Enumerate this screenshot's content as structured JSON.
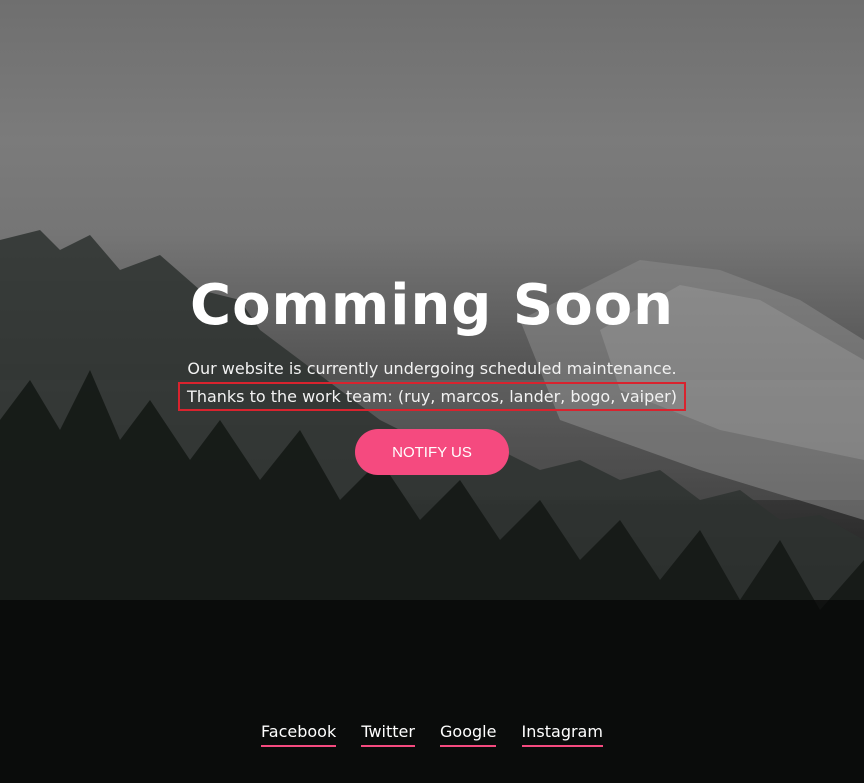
{
  "hero": {
    "title": "Comming Soon",
    "line1": "Our website is currently undergoing scheduled maintenance.",
    "line2": "Thanks to the work team: (ruy, marcos, lander, bogo, vaiper)",
    "button_label": "NOTIFY US"
  },
  "footer": {
    "links": [
      "Facebook",
      "Twitter",
      "Google",
      "Instagram"
    ]
  },
  "colors": {
    "accent": "#f54a7f",
    "highlight_border": "#d9232e",
    "text": "#ffffff"
  }
}
